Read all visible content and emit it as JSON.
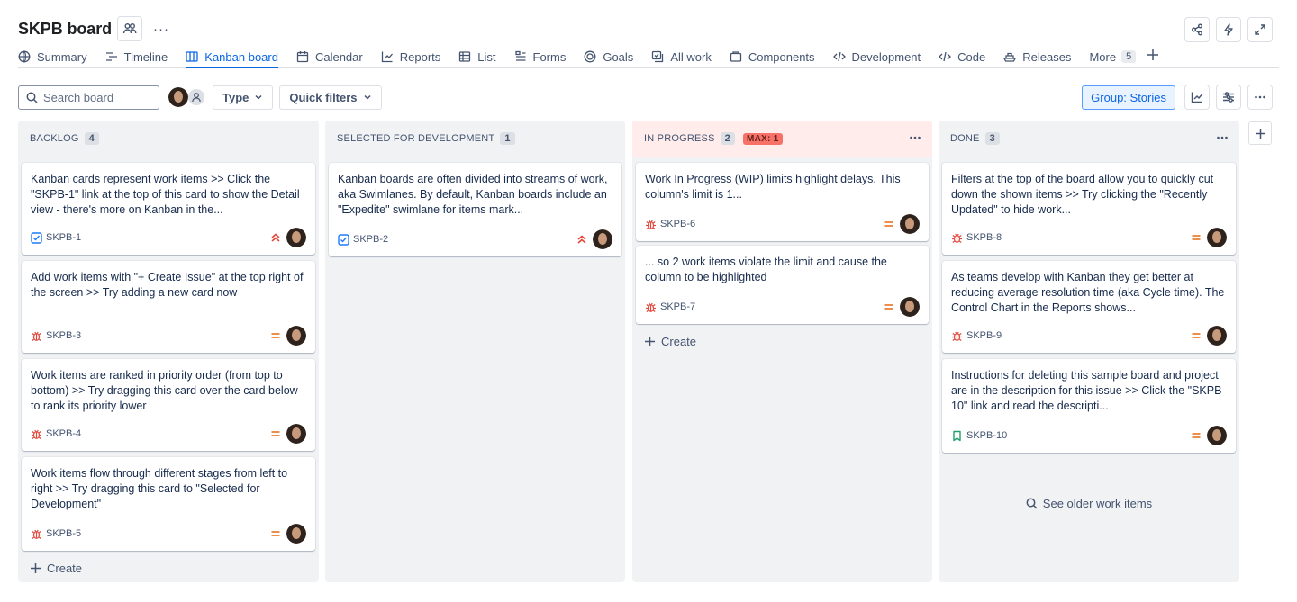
{
  "header": {
    "title": "SKPB board",
    "more_label": "···"
  },
  "tabs": [
    {
      "label": "Summary",
      "icon": "globe-icon"
    },
    {
      "label": "Timeline",
      "icon": "timeline-icon"
    },
    {
      "label": "Kanban board",
      "icon": "board-icon",
      "active": true
    },
    {
      "label": "Calendar",
      "icon": "calendar-icon"
    },
    {
      "label": "Reports",
      "icon": "chart-icon"
    },
    {
      "label": "List",
      "icon": "list-icon"
    },
    {
      "label": "Forms",
      "icon": "forms-icon"
    },
    {
      "label": "Goals",
      "icon": "goals-icon"
    },
    {
      "label": "All work",
      "icon": "all-work-icon"
    },
    {
      "label": "Components",
      "icon": "components-icon"
    },
    {
      "label": "Development",
      "icon": "code-icon"
    },
    {
      "label": "Code",
      "icon": "code-icon"
    },
    {
      "label": "Releases",
      "icon": "ship-icon"
    },
    {
      "label": "More",
      "count": "5"
    }
  ],
  "toolbar": {
    "search_placeholder": "Search board",
    "type_label": "Type",
    "quick_filters_label": "Quick filters",
    "group_label": "Group: Stories"
  },
  "columns": [
    {
      "name": "BACKLOG",
      "count": "4",
      "cards": [
        {
          "text": "Kanban cards represent work items >> Click the \"SKPB-1\" link at the top of this card to show the Detail view - there's more on Kanban in the...",
          "key": "SKPB-1",
          "type": "story",
          "priority": "highest"
        },
        {
          "text": "Add work items with \"+ Create Issue\" at the top right of the screen >> Try adding a new card now",
          "key": "SKPB-3",
          "type": "bug",
          "priority": "medium"
        },
        {
          "text": "Work items are ranked in priority order (from top to bottom) >> Try dragging this card over the card below to rank its priority lower",
          "key": "SKPB-4",
          "type": "bug",
          "priority": "medium"
        },
        {
          "text": "Work items flow through different stages from left to right >> Try dragging this card to \"Selected for Development\"",
          "key": "SKPB-5",
          "type": "bug",
          "priority": "medium"
        }
      ],
      "create_label": "Create"
    },
    {
      "name": "SELECTED FOR DEVELOPMENT",
      "count": "1",
      "cards": [
        {
          "text": "Kanban boards are often divided into streams of work, aka Swimlanes. By default, Kanban boards include an \"Expedite\" swimlane for items mark...",
          "key": "SKPB-2",
          "type": "story",
          "priority": "highest"
        }
      ]
    },
    {
      "name": "IN PROGRESS",
      "count": "2",
      "max": "MAX: 1",
      "cards": [
        {
          "text": "Work In Progress (WIP) limits highlight delays. This column's limit is 1...",
          "key": "SKPB-6",
          "type": "bug",
          "priority": "medium"
        },
        {
          "text": "... so 2 work items violate the limit and cause the column to be highlighted",
          "key": "SKPB-7",
          "type": "bug",
          "priority": "medium"
        }
      ],
      "create_label": "Create"
    },
    {
      "name": "DONE",
      "count": "3",
      "cards": [
        {
          "text": "Filters at the top of the board allow you to quickly cut down the shown items >> Try clicking the \"Recently Updated\" to hide work...",
          "key": "SKPB-8",
          "type": "bug",
          "priority": "medium"
        },
        {
          "text": "As teams develop with Kanban they get better at reducing average resolution time (aka Cycle time). The Control Chart in the Reports shows...",
          "key": "SKPB-9",
          "type": "bug",
          "priority": "medium"
        },
        {
          "text": "Instructions for deleting this sample board and project are in the description for this issue >> Click the \"SKPB-10\" link and read the descripti...",
          "key": "SKPB-10",
          "type": "bookmark",
          "priority": "medium"
        }
      ],
      "older_label": "See older work items"
    }
  ],
  "colors": {
    "accent": "#0c66e4",
    "bug": "#e2483d",
    "story": "#1d7afc",
    "highest": "#e2483d",
    "medium": "#e56910",
    "bookmark": "#22a06b",
    "wip_over": "#ffeceb"
  }
}
